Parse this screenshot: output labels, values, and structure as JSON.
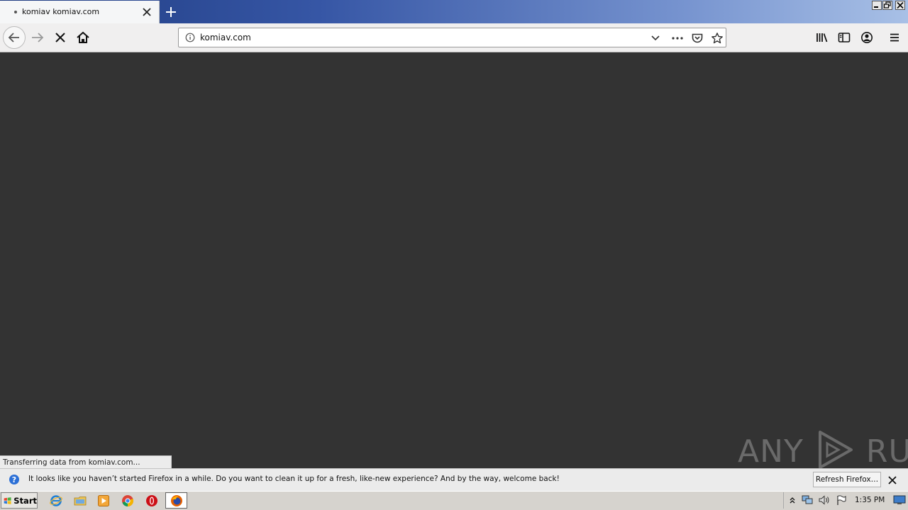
{
  "browser": {
    "tab": {
      "title": "komiav komiav.com"
    },
    "url": {
      "value": "komiav.com"
    }
  },
  "status": {
    "text": "Transferring data from komiav.com..."
  },
  "notification": {
    "message": "It looks like you haven’t started Firefox in a while. Do you want to clean it up for a fresh, like-new experience? And by the way, welcome back!",
    "refresh_label": "Refresh Firefox…"
  },
  "taskbar": {
    "start_label": "Start",
    "clock": "1:35 PM"
  },
  "watermark": {
    "left": "ANY",
    "right": "RUN"
  },
  "icons": [
    "back-icon",
    "forward-icon",
    "stop-icon",
    "home-icon",
    "info-icon",
    "dropdown-icon",
    "more-icon",
    "pocket-icon",
    "star-icon",
    "library-icon",
    "sidebar-icon",
    "account-icon",
    "menu-icon"
  ]
}
